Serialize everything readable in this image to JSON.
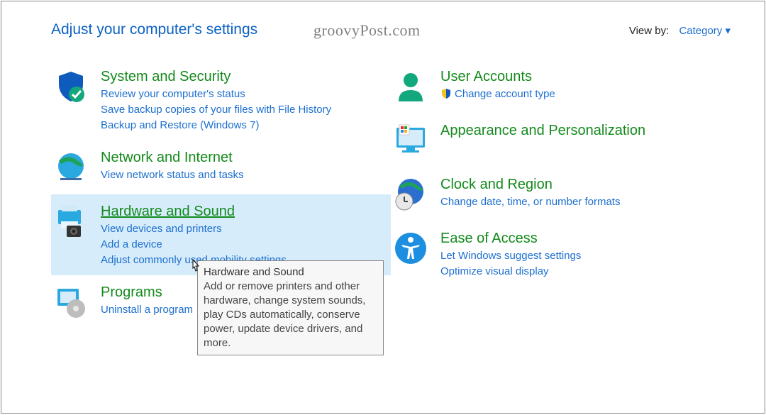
{
  "header": {
    "title": "Adjust your computer's settings",
    "watermark": "groovyPost.com",
    "view_by_label": "View by:",
    "view_by_value": "Category ▾"
  },
  "left_categories": [
    {
      "key": "system-security",
      "icon": "shield-check-icon",
      "title": "System and Security",
      "links": [
        "Review your computer's status",
        "Save backup copies of your files with File History",
        "Backup and Restore (Windows 7)"
      ]
    },
    {
      "key": "network-internet",
      "icon": "globe-icon",
      "title": "Network and Internet",
      "links": [
        "View network status and tasks"
      ]
    },
    {
      "key": "hardware-sound",
      "icon": "printer-camera-icon",
      "title": "Hardware and Sound",
      "hovered": true,
      "links": [
        "View devices and printers",
        "Add a device",
        "Adjust commonly used mobility settings"
      ]
    },
    {
      "key": "programs",
      "icon": "programs-icon",
      "title": "Programs",
      "links": [
        "Uninstall a program"
      ]
    }
  ],
  "right_categories": [
    {
      "key": "user-accounts",
      "icon": "user-icon",
      "title": "User Accounts",
      "links": [
        {
          "shield": true,
          "label": "Change account type"
        }
      ]
    },
    {
      "key": "appearance",
      "icon": "monitor-icon",
      "title": "Appearance and Personalization",
      "links": []
    },
    {
      "key": "clock-region",
      "icon": "globe-clock-icon",
      "title": "Clock and Region",
      "links": [
        "Change date, time, or number formats"
      ]
    },
    {
      "key": "ease-access",
      "icon": "accessibility-icon",
      "title": "Ease of Access",
      "links": [
        "Let Windows suggest settings",
        "Optimize visual display"
      ]
    }
  ],
  "tooltip": {
    "title": "Hardware and Sound",
    "body": "Add or remove printers and other hardware, change system sounds, play CDs automatically, conserve power, update device drivers, and more."
  }
}
